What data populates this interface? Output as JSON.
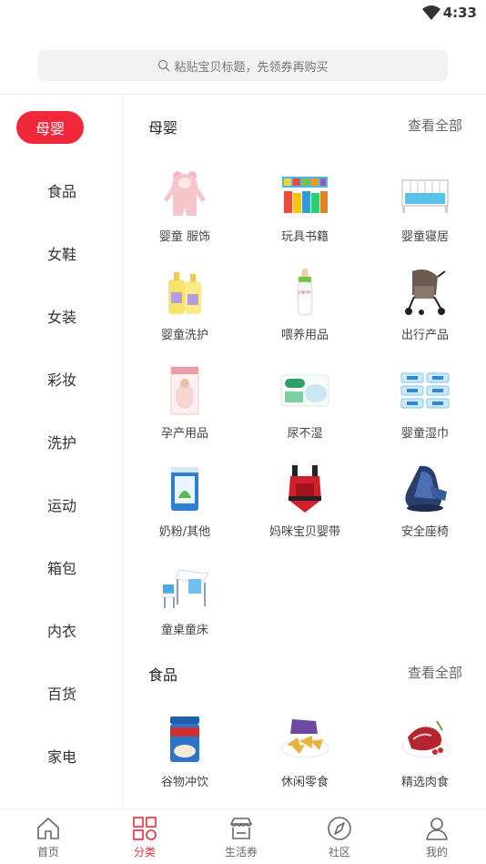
{
  "status_bar": {
    "time": "4:33"
  },
  "search": {
    "placeholder": "粘贴宝贝标题，先领券再购买"
  },
  "sidebar": {
    "items": [
      {
        "label": "母婴",
        "active": true
      },
      {
        "label": "食品"
      },
      {
        "label": "女鞋"
      },
      {
        "label": "女装"
      },
      {
        "label": "彩妆"
      },
      {
        "label": "洗护"
      },
      {
        "label": "运动"
      },
      {
        "label": "箱包"
      },
      {
        "label": "内衣"
      },
      {
        "label": "百货"
      },
      {
        "label": "家电"
      }
    ]
  },
  "sections": [
    {
      "title": "母婴",
      "more": "查看全部",
      "items": [
        {
          "label": "婴童 服饰",
          "icon": "baby-romper-image"
        },
        {
          "label": "玩具书籍",
          "icon": "toy-books-image"
        },
        {
          "label": "婴童寝居",
          "icon": "baby-crib-image"
        },
        {
          "label": "婴童洗护",
          "icon": "baby-wash-bottles-image"
        },
        {
          "label": "喂养用品",
          "icon": "feeding-bottle-image"
        },
        {
          "label": "出行产品",
          "icon": "stroller-image"
        },
        {
          "label": "孕产用品",
          "icon": "maternity-product-image"
        },
        {
          "label": "尿不湿",
          "icon": "diapers-image"
        },
        {
          "label": "婴童湿巾",
          "icon": "baby-wipes-image"
        },
        {
          "label": "奶粉/其他",
          "icon": "milk-powder-image"
        },
        {
          "label": "妈咪宝贝婴带",
          "icon": "baby-carrier-image"
        },
        {
          "label": "安全座椅",
          "icon": "car-seat-image"
        },
        {
          "label": "童桌童床",
          "icon": "kids-desk-image"
        }
      ]
    },
    {
      "title": "食品",
      "more": "查看全部",
      "items": [
        {
          "label": "谷物冲饮",
          "icon": "cereal-drink-image"
        },
        {
          "label": "休闲零食",
          "icon": "snacks-image"
        },
        {
          "label": "精选肉食",
          "icon": "meat-image"
        }
      ]
    }
  ],
  "tabbar": {
    "tabs": [
      {
        "label": "首页",
        "icon": "home-icon"
      },
      {
        "label": "分类",
        "icon": "category-icon",
        "active": true
      },
      {
        "label": "生活券",
        "icon": "store-icon"
      },
      {
        "label": "社区",
        "icon": "compass-icon"
      },
      {
        "label": "我的",
        "icon": "user-icon"
      }
    ]
  },
  "colors": {
    "accent": "#f0283c",
    "inactive": "#666666"
  }
}
